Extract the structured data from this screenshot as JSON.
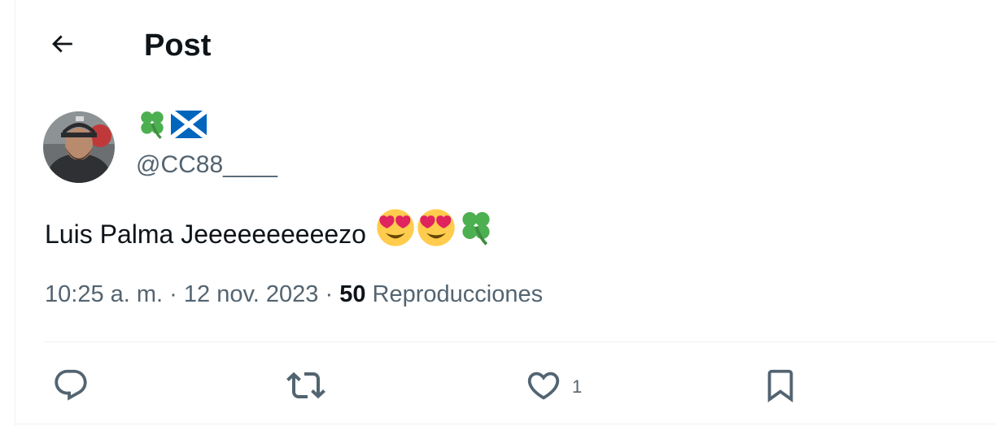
{
  "header": {
    "title": "Post",
    "back_icon": "arrow-left-icon"
  },
  "author": {
    "display_name_emojis": [
      "four-leaf-clover-emoji",
      "scotland-flag-emoji"
    ],
    "handle": "@CC88____"
  },
  "post": {
    "text": "Luis Palma Jeeeeeeeeeezo",
    "emojis": [
      "heart-eyes-emoji",
      "heart-eyes-emoji",
      "four-leaf-clover-emoji"
    ],
    "time": "10:25 a. m.",
    "date": "12 nov. 2023",
    "views_count": "50",
    "views_label": "Reproducciones"
  },
  "actions": {
    "reply_icon": "reply-icon",
    "repost_icon": "repost-icon",
    "like_icon": "heart-icon",
    "like_count": "1",
    "bookmark_icon": "bookmark-icon"
  },
  "colors": {
    "text_primary": "#0f1419",
    "text_secondary": "#536471",
    "border": "#eff3f4",
    "clover_green": "#4caf50",
    "flag_blue": "#0065bd",
    "emoji_yellow": "#ffcc4d",
    "heart_red": "#e0245e"
  }
}
